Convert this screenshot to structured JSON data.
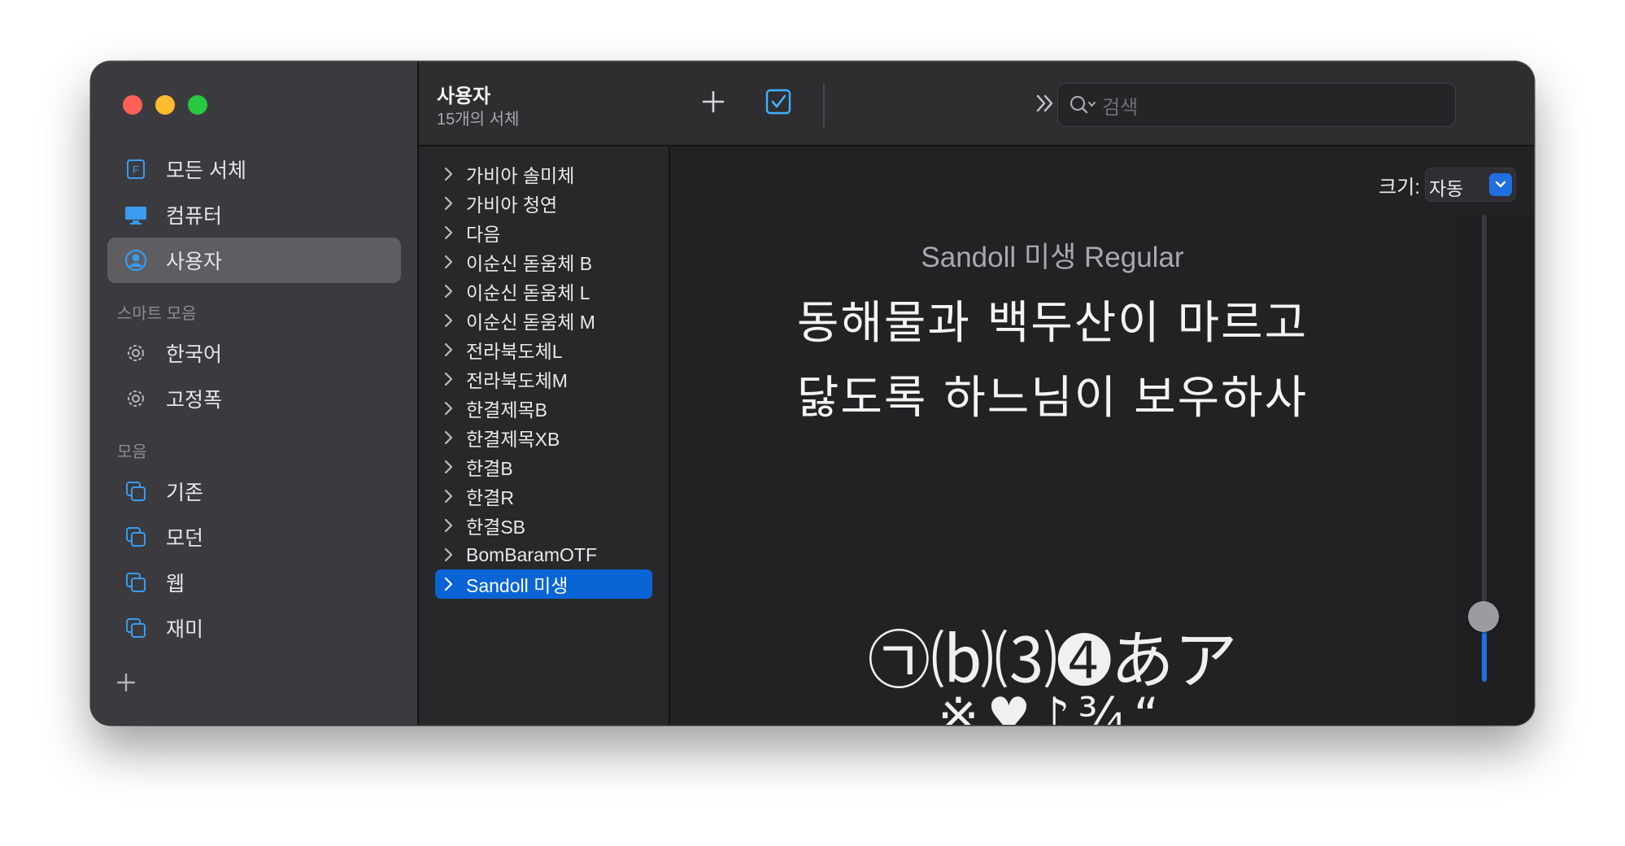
{
  "window": {
    "traffic_lights": [
      "close",
      "minimize",
      "zoom"
    ]
  },
  "sidebar": {
    "library_items": [
      {
        "label": "모든 서체",
        "icon": "font-book-icon"
      },
      {
        "label": "컴퓨터",
        "icon": "monitor-icon"
      },
      {
        "label": "사용자",
        "icon": "user-circle-icon",
        "active": true
      }
    ],
    "smart_header": "스마트 모음",
    "smart_items": [
      {
        "label": "한국어",
        "icon": "gear-icon"
      },
      {
        "label": "고정폭",
        "icon": "gear-icon"
      }
    ],
    "collection_header": "모음",
    "collection_items": [
      {
        "label": "기존",
        "icon": "collection-icon"
      },
      {
        "label": "모던",
        "icon": "collection-icon"
      },
      {
        "label": "웹",
        "icon": "collection-icon"
      },
      {
        "label": "재미",
        "icon": "collection-icon"
      }
    ]
  },
  "toolbar": {
    "title": "사용자",
    "subtitle": "15개의 서체",
    "search_placeholder": "검색"
  },
  "font_list": [
    "가비아 솔미체",
    "가비아 청연",
    "다음",
    "이순신 돋움체 B",
    "이순신 돋움체 L",
    "이순신 돋움체 M",
    "전라북도체L",
    "전라북도체M",
    "한결제목B",
    "한결제목XB",
    "한결B",
    "한결R",
    "한결SB",
    "BomBaramOTF",
    "Sandoll 미생"
  ],
  "selected_index": 14,
  "preview": {
    "size_label": "크기:",
    "size_value": "자동",
    "font_name": "Sandoll 미생 Regular",
    "sample_line1": "동해물과 백두산이 마르고",
    "sample_line2": "닳도록 하느님이 보우하사",
    "glyph_line1": "㉠⒝⑶➍あア",
    "glyph_line2": "※♥♪¾“",
    "slider_level": 0.14
  },
  "colors": {
    "accent": "#0a64d6",
    "sidebar_icon": "#3a9bf0",
    "check_blue": "#3fb2ff"
  }
}
